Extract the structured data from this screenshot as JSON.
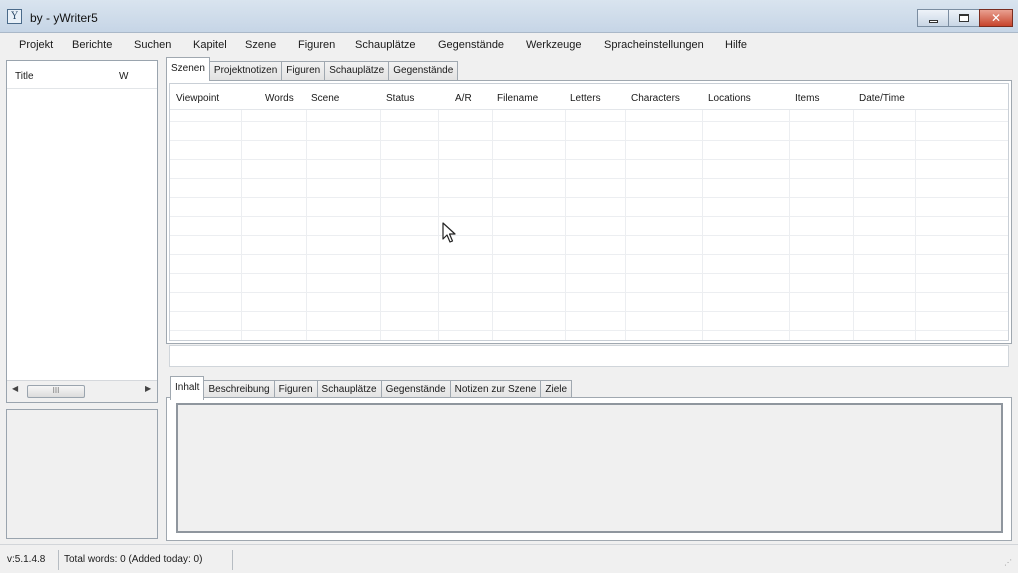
{
  "window": {
    "title": "by  - yWriter5",
    "icon": "yw-logo-icon"
  },
  "menu": [
    "Projekt",
    "Berichte",
    "Suchen",
    "Kapitel",
    "Szene",
    "Figuren",
    "Schauplätze",
    "Gegenstände",
    "Werkzeuge",
    "Spracheinstellungen",
    "Hilfe"
  ],
  "left_list": {
    "columns": [
      "Title",
      "W"
    ],
    "scroll_thumb": "III"
  },
  "top_tabs": [
    "Szenen",
    "Projektnotizen",
    "Figuren",
    "Schauplätze",
    "Gegenstände"
  ],
  "top_tab_active": "Szenen",
  "scene_table": {
    "columns": [
      "Viewpoint",
      "Words",
      "Scene",
      "Status",
      "A/R",
      "Filename",
      "Letters",
      "Characters",
      "Locations",
      "Items",
      "Date/Time"
    ],
    "rows": []
  },
  "bottom_tabs": [
    "Inhalt",
    "Beschreibung",
    "Figuren",
    "Schauplätze",
    "Gegenstände",
    "Notizen zur Szene",
    "Ziele"
  ],
  "bottom_tab_active": "Inhalt",
  "status": {
    "version": "v:5.1.4.8",
    "total_words": "Total words: 0 (Added today: 0)"
  },
  "colors": {
    "titlebar": "#c6d5e6",
    "close_button": "#c7442c",
    "window_bg": "#f0f0f0"
  }
}
